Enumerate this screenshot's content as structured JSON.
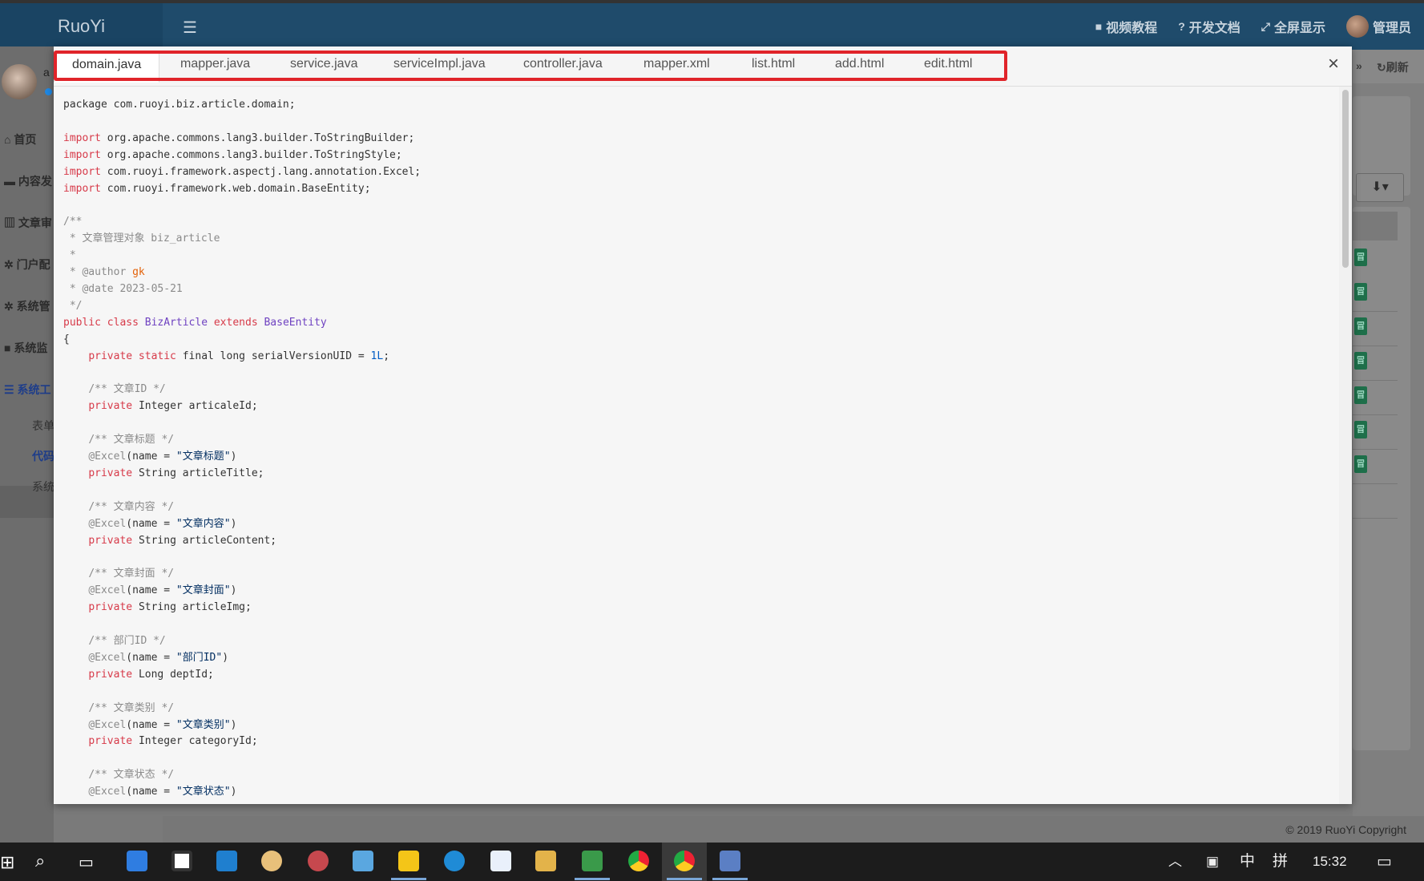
{
  "app": {
    "brand": "RuoYi",
    "menu_icon": "hamburger-icon"
  },
  "topnav": [
    {
      "icon": "video-icon",
      "label": "视频教程"
    },
    {
      "icon": "help-icon",
      "label": "开发文档"
    },
    {
      "icon": "fullscreen-icon",
      "label": "全屏显示"
    },
    {
      "icon": "avatar",
      "label": "管理员"
    }
  ],
  "sidebar": {
    "user_initial": "a",
    "items": [
      {
        "icon": "home-icon",
        "label": "首页"
      },
      {
        "icon": "briefcase-icon",
        "label": "内容发"
      },
      {
        "icon": "bank-icon",
        "label": "文章审"
      },
      {
        "icon": "gear-icon",
        "label": "门户配"
      },
      {
        "icon": "gear-icon",
        "label": "系统管"
      },
      {
        "icon": "video-icon",
        "label": "系统监"
      },
      {
        "icon": "list-icon",
        "label": "系统工"
      }
    ],
    "subitems": [
      "表单",
      "代码",
      "系统"
    ]
  },
  "right_panel": {
    "refresh_label": "刷新",
    "badge_text": "冒"
  },
  "footer": {
    "copyright": "© 2019 RuoYi Copyright"
  },
  "modal": {
    "tabs": [
      "domain.java",
      "mapper.java",
      "service.java",
      "serviceImpl.java",
      "controller.java",
      "mapper.xml",
      "list.html",
      "add.html",
      "edit.html"
    ],
    "active_tab": "domain.java",
    "close_label": "×",
    "code": {
      "package": "package com.ruoyi.biz.article.domain;",
      "imports": [
        "org.apache.commons.lang3.builder.ToStringBuilder;",
        "org.apache.commons.lang3.builder.ToStringStyle;",
        "com.ruoyi.framework.aspectj.lang.annotation.Excel;",
        "com.ruoyi.framework.web.domain.BaseEntity;"
      ],
      "doc_title": " * 文章管理对象 biz_article",
      "author": "gk",
      "date": "2023-05-21",
      "class_name": "BizArticle",
      "base_class": "BaseEntity",
      "serial": "serialVersionUID = ",
      "serial_value": "1L",
      "fields": [
        {
          "comment": "/** 文章ID */",
          "excel": "",
          "type": "Integer",
          "name": "articaleId;"
        },
        {
          "comment": "/** 文章标题 */",
          "excel": "\"文章标题\"",
          "type": "String",
          "name": "articleTitle;"
        },
        {
          "comment": "/** 文章内容 */",
          "excel": "\"文章内容\"",
          "type": "String",
          "name": "articleContent;"
        },
        {
          "comment": "/** 文章封面 */",
          "excel": "\"文章封面\"",
          "type": "String",
          "name": "articleImg;"
        },
        {
          "comment": "/** 部门ID */",
          "excel": "\"部门ID\"",
          "type": "Long",
          "name": "deptId;"
        },
        {
          "comment": "/** 文章类别 */",
          "excel": "\"文章类别\"",
          "type": "Integer",
          "name": "categoryId;"
        },
        {
          "comment": "/** 文章状态 */",
          "excel": "\"文章状态\"",
          "type": "",
          "name": ""
        }
      ]
    }
  },
  "taskbar": {
    "ime_lang": "中",
    "ime_mode": "拼",
    "clock": "15:32"
  }
}
